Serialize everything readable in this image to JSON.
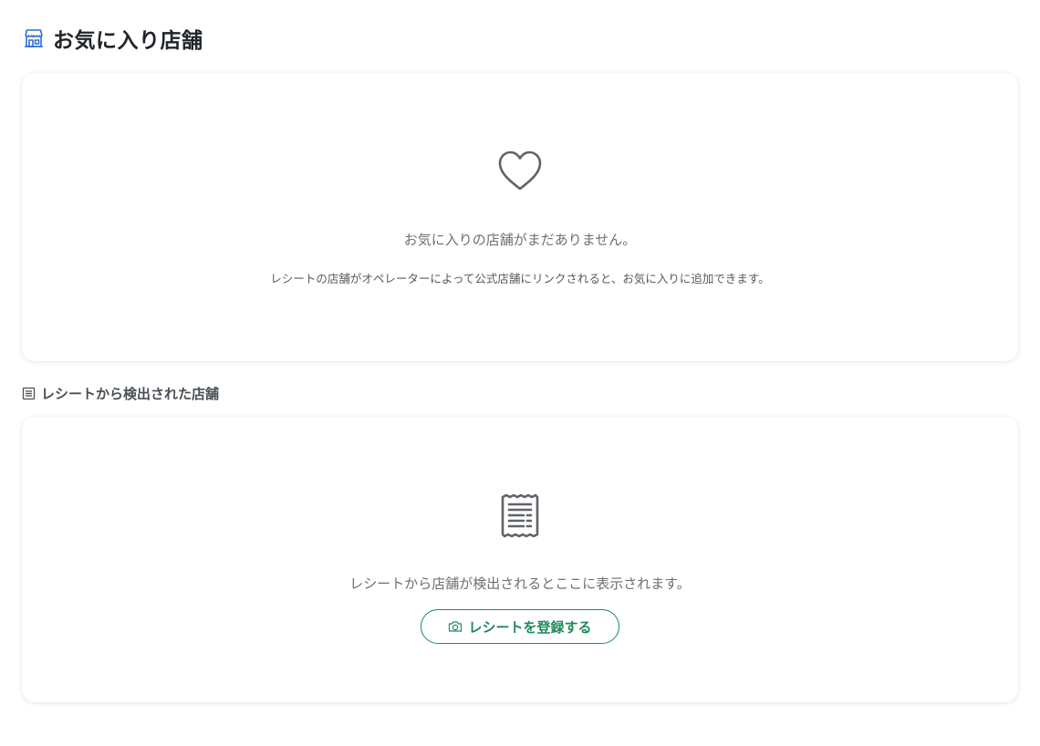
{
  "header": {
    "title": "お気に入り店舗",
    "icon": "store-icon",
    "icon_color": "#2f6fd6"
  },
  "favorites": {
    "icon": "heart-icon",
    "empty_message": "お気に入りの店舗がまだありません。",
    "description": "レシートの店舗がオペレーターによって公式店舗にリンクされると、お気に入りに追加できます。"
  },
  "receipt_section": {
    "icon": "receipt-icon",
    "title": "レシートから検出された店舗",
    "empty_icon": "receipt-icon",
    "empty_message": "レシートから店舗が検出されるとここに表示されます。",
    "button": {
      "icon": "camera-icon",
      "label": "レシートを登録する"
    }
  },
  "colors": {
    "accent_green": "#1e8a5a",
    "icon_gray": "#5f6368",
    "text_muted": "#6c6f74"
  }
}
